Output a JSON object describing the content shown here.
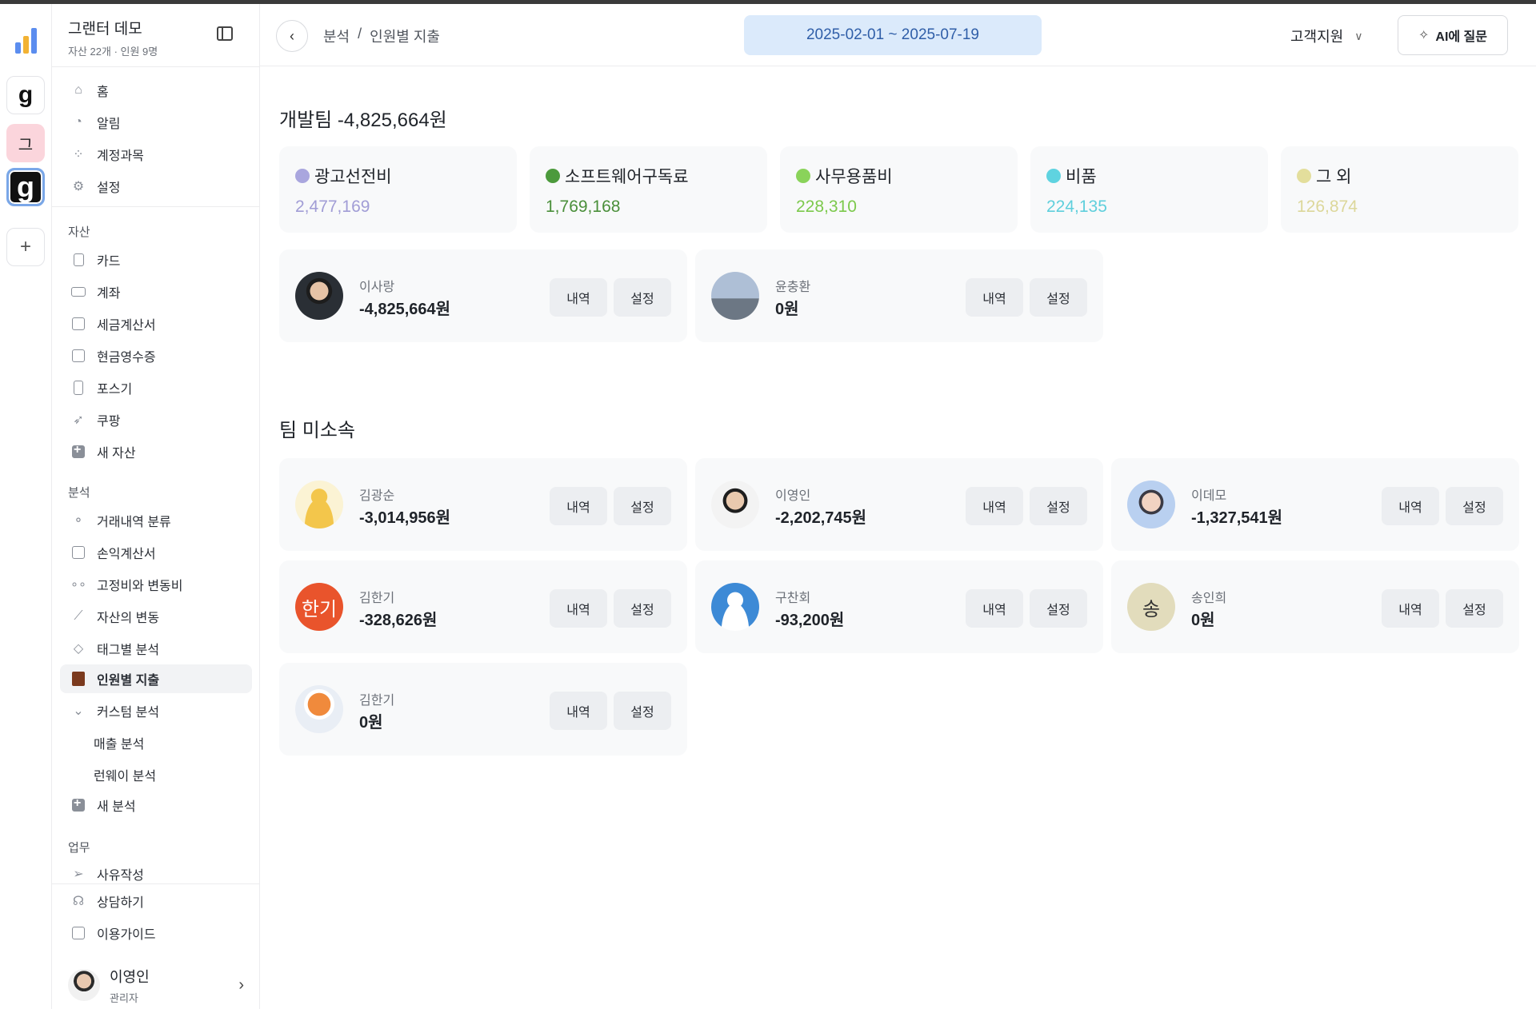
{
  "rail": {
    "add_label": "+",
    "workspaces": [
      {
        "letter": "g"
      },
      {
        "letter": "그"
      },
      {
        "letter": "g"
      }
    ],
    "chart_colors": [
      "#5b8def",
      "#f2b233",
      "#5b8def"
    ]
  },
  "org": {
    "name": "그랜터 데모",
    "subtitle": "자산 22개 · 인원 9명"
  },
  "nav_top": [
    {
      "label": "홈",
      "icon": "home-icon"
    },
    {
      "label": "알림",
      "icon": "bell-icon"
    },
    {
      "label": "계정과목",
      "icon": "grid-icon"
    },
    {
      "label": "설정",
      "icon": "gear-icon"
    }
  ],
  "assets": {
    "title": "자산",
    "items": [
      {
        "label": "카드",
        "icon": "card-icon"
      },
      {
        "label": "계좌",
        "icon": "bank-card-icon"
      },
      {
        "label": "세금계산서",
        "icon": "tax-icon"
      },
      {
        "label": "현금영수증",
        "icon": "receipt-icon"
      },
      {
        "label": "포스기",
        "icon": "pos-icon"
      },
      {
        "label": "쿠팡",
        "icon": "rocket-icon"
      },
      {
        "label": "새 자산",
        "icon": "plus-box-icon"
      }
    ]
  },
  "analysis": {
    "title": "분석",
    "items": [
      {
        "label": "거래내역 분류",
        "icon": "flow-icon"
      },
      {
        "label": "손익계산서",
        "icon": "ledger-icon"
      },
      {
        "label": "고정비와 변동비",
        "icon": "dots-icon"
      },
      {
        "label": "자산의 변동",
        "icon": "trend-icon"
      },
      {
        "label": "태그별 분석",
        "icon": "tag-icon"
      },
      {
        "label": "인원별 지출",
        "icon": "person-book-icon"
      },
      {
        "label": "커스텀 분석",
        "icon": "chevron-down-icon"
      },
      {
        "label": "매출 분석",
        "icon": ""
      },
      {
        "label": "런웨이 분석",
        "icon": ""
      },
      {
        "label": "새 분석",
        "icon": "plus-box-icon"
      }
    ]
  },
  "work": {
    "title": "업무",
    "items": [
      {
        "label": "사유작성",
        "icon": "send-icon"
      }
    ]
  },
  "footer_nav": [
    {
      "label": "상담하기",
      "icon": "headset-icon"
    },
    {
      "label": "이용가이드",
      "icon": "book-icon"
    }
  ],
  "user": {
    "name": "이영인",
    "role": "관리자"
  },
  "header": {
    "breadcrumb": [
      "분석",
      "/",
      "인원별 지출"
    ],
    "date_range": "2025-02-01 ~ 2025-07-19",
    "support": "고객지원",
    "ai_button": "AI에 질문"
  },
  "team": {
    "title": "개발팀 -4,825,664원",
    "categories": [
      {
        "name": "광고선전비",
        "value": "2,477,169",
        "color": "#a9a6de",
        "text_color": "#a19dd6"
      },
      {
        "name": "소프트웨어구독료",
        "value": "1,769,168",
        "color": "#4c9a3c",
        "text_color": "#4a8f3a"
      },
      {
        "name": "사무용품비",
        "value": "228,310",
        "color": "#8ad35a",
        "text_color": "#7cc94c"
      },
      {
        "name": "비품",
        "value": "224,135",
        "color": "#5fd3e0",
        "text_color": "#5fcfdc"
      },
      {
        "name": "그 외",
        "value": "126,874",
        "color": "#e3de9c",
        "text_color": "#dcd79a"
      }
    ],
    "members": [
      {
        "name": "이사랑",
        "amount": "-4,825,664원",
        "history": "내역",
        "settings": "설정"
      },
      {
        "name": "윤충환",
        "amount": "0원",
        "history": "내역",
        "settings": "설정"
      }
    ]
  },
  "unassigned": {
    "title": "팀 미소속",
    "members": [
      {
        "name": "김광순",
        "amount": "-3,014,956원",
        "history": "내역",
        "settings": "설정"
      },
      {
        "name": "이영인",
        "amount": "-2,202,745원",
        "history": "내역",
        "settings": "설정"
      },
      {
        "name": "이데모",
        "amount": "-1,327,541원",
        "history": "내역",
        "settings": "설정"
      },
      {
        "name": "김한기",
        "amount": "-328,626원",
        "history": "내역",
        "settings": "설정",
        "initials": "한기"
      },
      {
        "name": "구찬회",
        "amount": "-93,200원",
        "history": "내역",
        "settings": "설정"
      },
      {
        "name": "송인희",
        "amount": "0원",
        "history": "내역",
        "settings": "설정",
        "initials": "송"
      },
      {
        "name": "김한기",
        "amount": "0원",
        "history": "내역",
        "settings": "설정"
      }
    ]
  }
}
